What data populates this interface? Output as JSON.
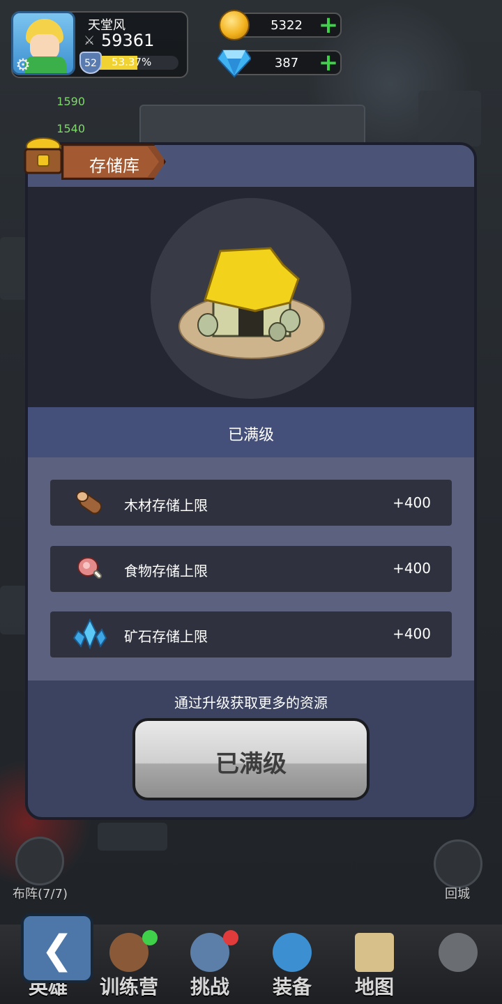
{
  "hud": {
    "player_name": "天堂风",
    "power": "59361",
    "level": "52",
    "exp_percent": "53.37%",
    "exp_fraction": 0.5337,
    "gold": "5322",
    "diamonds": "387"
  },
  "side_stats": [
    "1590",
    "1540"
  ],
  "panel": {
    "title": "存储库",
    "status": "已满级",
    "rows": [
      {
        "label": "木材存储上限",
        "value": "+400",
        "icon": "wood-log-icon"
      },
      {
        "label": "食物存储上限",
        "value": "+400",
        "icon": "meat-icon"
      },
      {
        "label": "矿石存储上限",
        "value": "+400",
        "icon": "crystal-ore-icon"
      }
    ],
    "hint": "通过升级获取更多的资源",
    "button_label": "已满级"
  },
  "side_buttons": {
    "formation": "布阵(7/7)",
    "return_city": "回城"
  },
  "nav": {
    "items": [
      "英雄",
      "训练营",
      "挑战",
      "装备",
      "地图"
    ]
  },
  "colors": {
    "panel": "#3b4361",
    "accent_green": "#3fd14a",
    "exp_bar": "#f0d233"
  }
}
